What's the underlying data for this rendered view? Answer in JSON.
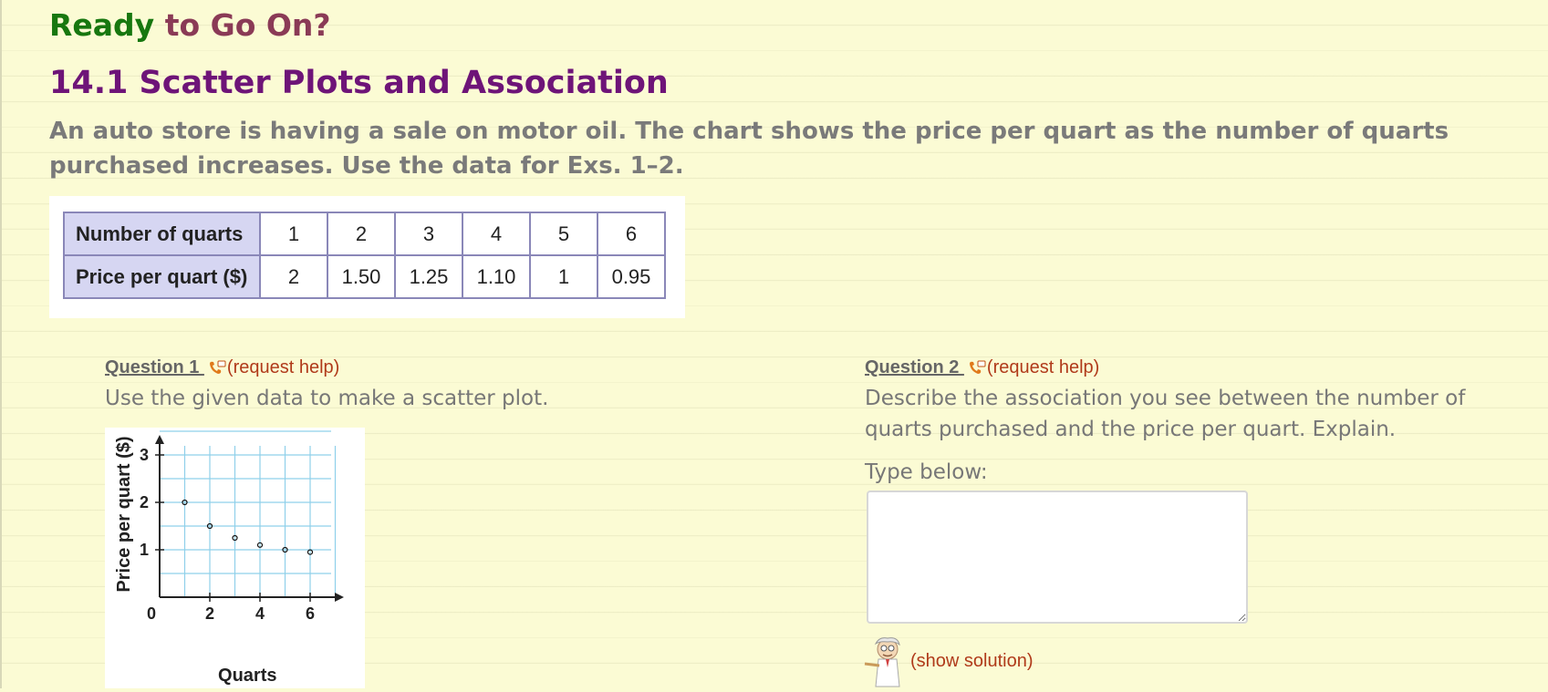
{
  "header": {
    "title_ready": "Ready",
    "title_rest": " to Go On?",
    "section_title": "14.1 Scatter Plots and Association",
    "intro": "An auto store is having a sale on motor oil. The chart shows the price per quart as the number of quarts purchased increases. Use the data for Exs. 1–2."
  },
  "table": {
    "rows": [
      {
        "label": "Number of quarts",
        "values": [
          "1",
          "2",
          "3",
          "4",
          "5",
          "6"
        ]
      },
      {
        "label": "Price per quart ($)",
        "values": [
          "2",
          "1.50",
          "1.25",
          "1.10",
          "1",
          "0.95"
        ]
      }
    ]
  },
  "question1": {
    "label": "Question 1 ",
    "help": "(request help)",
    "text": "Use the given data to make a scatter plot."
  },
  "question2": {
    "label": "Question 2 ",
    "help": "(request help)",
    "text": "Describe the association you see between the number of quarts purchased and the price per quart. Explain.",
    "type_below": "Type below:",
    "answer_value": "",
    "show_solution": "(show solution)"
  },
  "icons": {
    "help": "phone-help-icon",
    "professor": "professor-icon"
  },
  "colors": {
    "ready_green": "#17770f",
    "title_maroon": "#8a3a56",
    "section_purple": "#6e1478",
    "link_red": "#b03a1a",
    "grid_blue": "#8fd0ea",
    "table_header": "#d6d6f2"
  },
  "chart_data": {
    "type": "scatter",
    "x": [
      1,
      2,
      3,
      4,
      5,
      6
    ],
    "y": [
      2,
      1.5,
      1.25,
      1.1,
      1,
      0.95
    ],
    "xlabel": "Quarts",
    "ylabel": "Price per quart ($)",
    "xticks": [
      "0",
      "2",
      "4",
      "6"
    ],
    "yticks": [
      "1",
      "2",
      "3"
    ],
    "xlim": [
      0,
      7
    ],
    "ylim": [
      0,
      3.5
    ],
    "grid": true
  }
}
